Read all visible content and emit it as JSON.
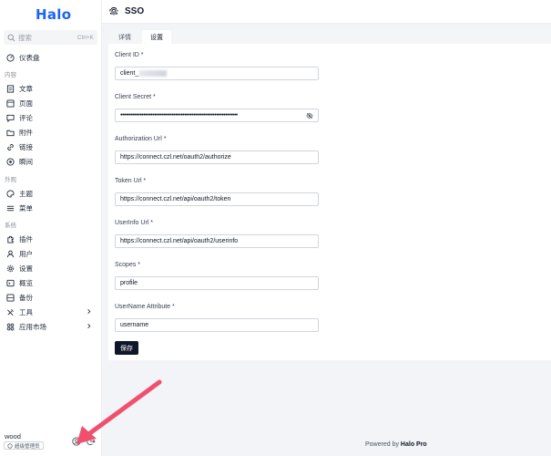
{
  "brand": {
    "logo_text": "Halo",
    "accent": "#1d64f2"
  },
  "search": {
    "placeholder": "搜索",
    "shortcut": "Ctrl+K"
  },
  "nav": {
    "dashboard": "仪表盘",
    "group_content": "内容",
    "posts": "文章",
    "pages": "页面",
    "comments": "评论",
    "attachments": "附件",
    "links": "链接",
    "moments": "瞬间",
    "group_appearance": "外观",
    "themes": "主题",
    "menus": "菜单",
    "group_system": "系统",
    "plugins": "插件",
    "users": "用户",
    "settings": "设置",
    "overview": "概览",
    "backup": "备份",
    "tools": "工具",
    "app_market": "应用市场"
  },
  "user": {
    "name": "wood",
    "role": "超级管理员"
  },
  "header": {
    "title": "SSO",
    "icon": "fingerprint-icon"
  },
  "tabs": [
    {
      "label": "详情"
    },
    {
      "label": "设置"
    }
  ],
  "active_tab": "设置",
  "form": {
    "client_id_label": "Client ID *",
    "client_id_value": "client_",
    "client_secret_label": "Client Secret *",
    "client_secret_value": "••••••••••••••••••••••••••••••••••••••••••••••••••••••••••••••••••",
    "auth_url_label": "Authorization Url *",
    "auth_url_value": "https://connect.czl.net/oauth2/authorize",
    "token_url_label": "Token Url *",
    "token_url_value": "https://connect.czl.net/api/oauth2/token",
    "userinfo_url_label": "UserInfo Url *",
    "userinfo_url_value": "https://connect.czl.net/api/oauth2/userinfo",
    "scopes_label": "Scopes *",
    "scopes_value": "profile",
    "username_attr_label": "UserName Attribute *",
    "username_attr_value": "username",
    "save_label": "保存"
  },
  "footer": {
    "prefix": "Powered by",
    "brand": "Halo Pro"
  },
  "annotation": {
    "arrow_color": "#f0506e"
  }
}
